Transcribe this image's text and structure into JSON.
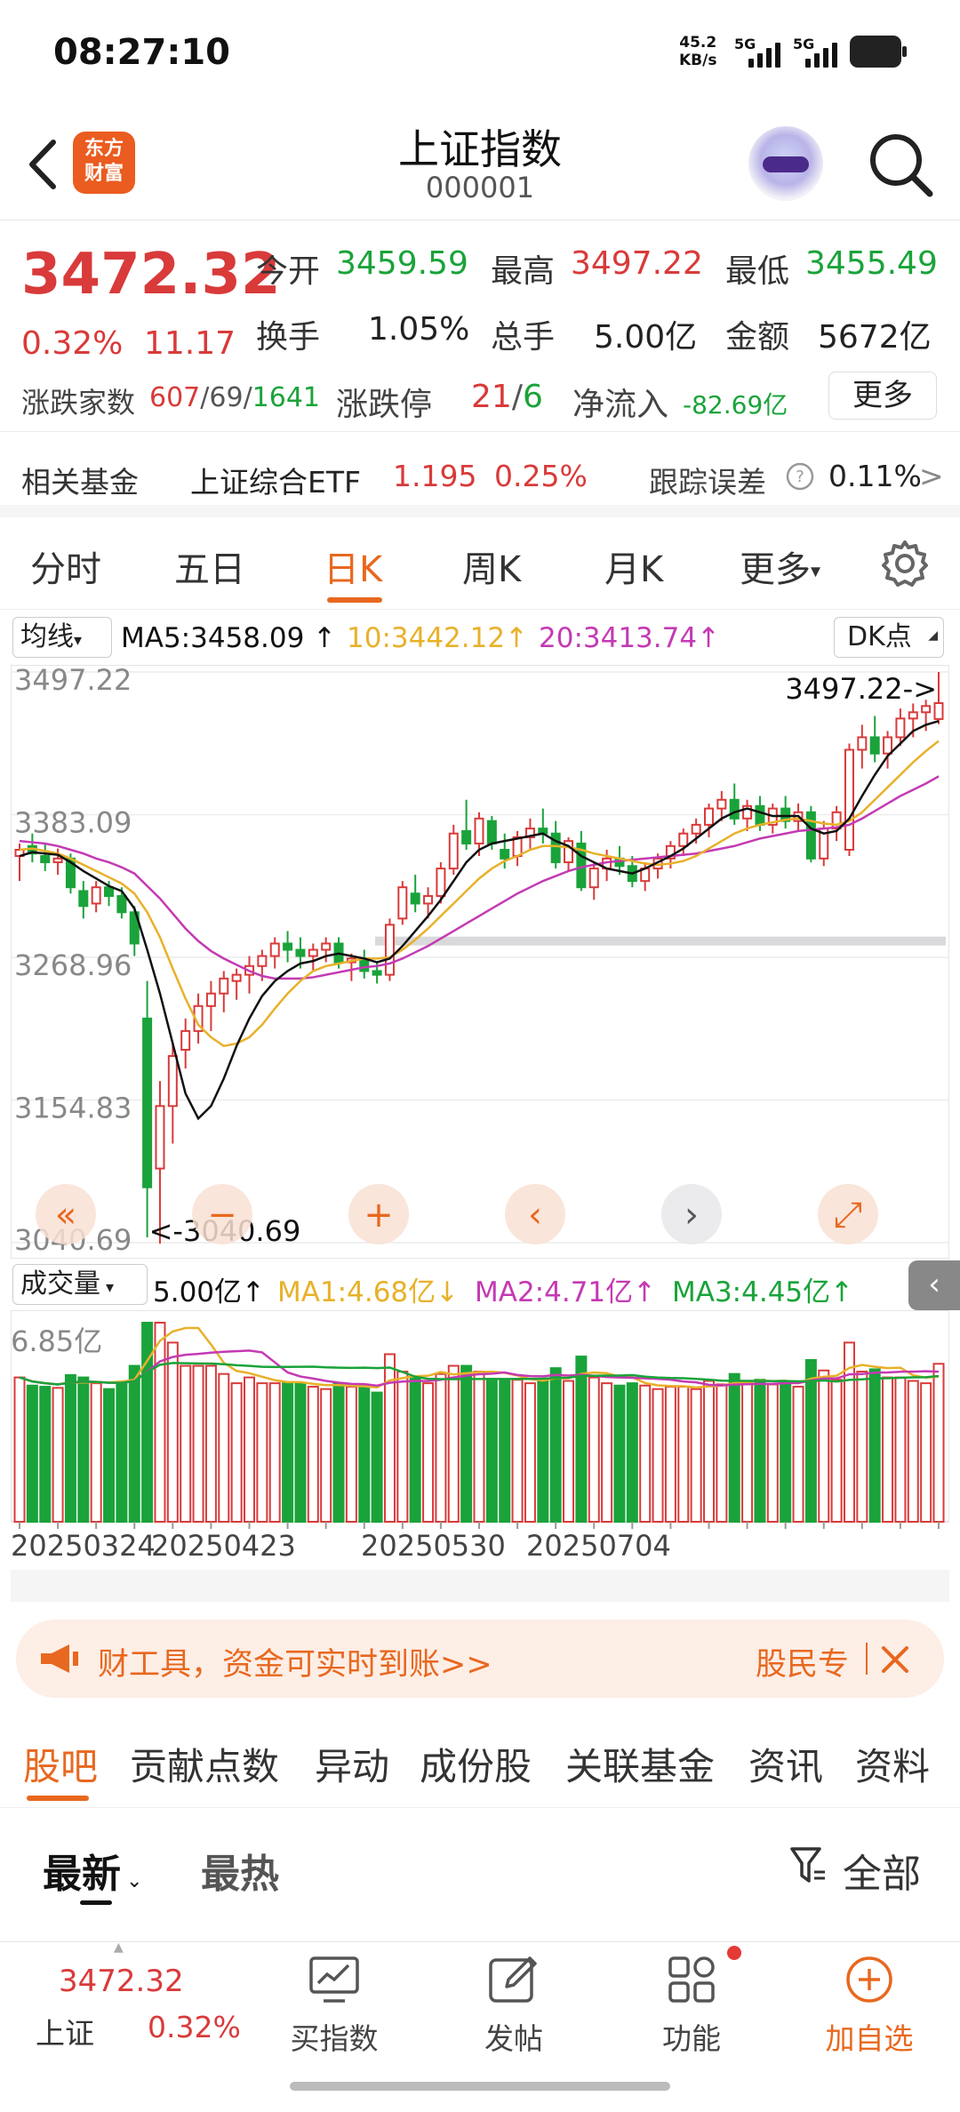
{
  "status_bar": {
    "time": "08:27:10",
    "net_speed": "45.2",
    "net_unit": "KB/s",
    "sim1": "5G",
    "sim2": "5G"
  },
  "header": {
    "title": "上证指数",
    "code": "000001",
    "logo_line1": "东方",
    "logo_line2": "财富"
  },
  "quote": {
    "price": "3472.32",
    "change_pct": "0.32%",
    "change": "11.17",
    "open_label": "今开",
    "open": "3459.59",
    "high_label": "最高",
    "high": "3497.22",
    "low_label": "最低",
    "low": "3455.49",
    "turnover_label": "换手",
    "turnover": "1.05%",
    "volume_label": "总手",
    "volume": "5.00亿",
    "amount_label": "金额",
    "amount": "5672亿",
    "breadth_label": "涨跌家数",
    "breadth_up": "607",
    "breadth_sep1": "/",
    "breadth_flat": "69",
    "breadth_sep2": "/",
    "breadth_down": "1641",
    "limit_label": "涨跌停",
    "limit_up": "21",
    "limit_sep": "/",
    "limit_down": "6",
    "netflow_label": "净流入",
    "netflow": "-82.69亿",
    "more_label": "更多"
  },
  "fund": {
    "label": "相关基金",
    "name": "上证综合ETF",
    "price": "1.195",
    "pct": "0.25%",
    "err_label": "跟踪误差",
    "err": "0.11%"
  },
  "tabs": [
    {
      "label": "分时"
    },
    {
      "label": "五日"
    },
    {
      "label": "日K"
    },
    {
      "label": "周K"
    },
    {
      "label": "月K"
    },
    {
      "label": "更多"
    }
  ],
  "ma_row": {
    "selector": "均线",
    "ma5": "MA5:3458.09",
    "ma10": "10:3442.12",
    "ma20": "20:3413.74",
    "dk": "DK点"
  },
  "kline": {
    "y_ticks": [
      "3497.22",
      "3383.09",
      "3268.96",
      "3154.83",
      "3040.69"
    ],
    "high_mark": "3497.22->",
    "low_mark": "<-3040.69"
  },
  "vol_row": {
    "selector": "成交量",
    "value": "5.00亿",
    "ma1": "MA1:4.68亿",
    "ma2": "MA2:4.71亿",
    "ma3": "MA3:4.45亿"
  },
  "volume": {
    "y_tick": "6.85亿",
    "dates": [
      "20250324",
      "20250423",
      "20250530",
      "20250704"
    ]
  },
  "ticker": {
    "text": "财工具，资金可实时到账>>",
    "right": "股民专"
  },
  "lower_tabs": [
    {
      "label": "股吧"
    },
    {
      "label": "贡献点数"
    },
    {
      "label": "异动"
    },
    {
      "label": "成份股"
    },
    {
      "label": "关联基金"
    },
    {
      "label": "资讯"
    },
    {
      "label": "资料"
    }
  ],
  "sort": {
    "latest": "最新",
    "hot": "最热",
    "filter": "全部"
  },
  "bottom_bar": {
    "index_price": "3472.32",
    "index_name": "上证",
    "index_pct": "0.32%",
    "buy": "买指数",
    "post": "发帖",
    "func": "功能",
    "add": "加自选"
  },
  "colors": {
    "up": "#d93a3a",
    "down": "#1aa33a",
    "accent": "#e8681f",
    "ma5": "#111111",
    "ma10": "#e8b12a",
    "ma20": "#c43ab3"
  },
  "chart_data": {
    "type": "candlestick",
    "ylim": [
      3040.69,
      3497.22
    ],
    "high": 3497.22,
    "low": 3040.69,
    "candles": [
      [
        3350,
        3360,
        3330,
        3355
      ],
      [
        3358,
        3368,
        3345,
        3352
      ],
      [
        3350,
        3360,
        3338,
        3345
      ],
      [
        3345,
        3356,
        3335,
        3348
      ],
      [
        3348,
        3352,
        3320,
        3325
      ],
      [
        3322,
        3330,
        3300,
        3310
      ],
      [
        3312,
        3330,
        3305,
        3325
      ],
      [
        3325,
        3330,
        3310,
        3318
      ],
      [
        3318,
        3325,
        3300,
        3305
      ],
      [
        3305,
        3310,
        3270,
        3280
      ],
      [
        3220,
        3250,
        3045,
        3085
      ],
      [
        3100,
        3170,
        3040,
        3150
      ],
      [
        3150,
        3200,
        3120,
        3190
      ],
      [
        3195,
        3220,
        3180,
        3210
      ],
      [
        3210,
        3240,
        3200,
        3230
      ],
      [
        3230,
        3250,
        3210,
        3240
      ],
      [
        3240,
        3258,
        3225,
        3252
      ],
      [
        3250,
        3260,
        3235,
        3255
      ],
      [
        3255,
        3270,
        3240,
        3262
      ],
      [
        3262,
        3275,
        3250,
        3270
      ],
      [
        3270,
        3285,
        3260,
        3280
      ],
      [
        3280,
        3290,
        3265,
        3275
      ],
      [
        3275,
        3285,
        3260,
        3270
      ],
      [
        3270,
        3280,
        3258,
        3275
      ],
      [
        3275,
        3285,
        3265,
        3280
      ],
      [
        3280,
        3285,
        3260,
        3265
      ],
      [
        3265,
        3272,
        3250,
        3268
      ],
      [
        3268,
        3275,
        3252,
        3258
      ],
      [
        3258,
        3265,
        3248,
        3255
      ],
      [
        3255,
        3300,
        3250,
        3295
      ],
      [
        3300,
        3330,
        3295,
        3325
      ],
      [
        3320,
        3335,
        3305,
        3312
      ],
      [
        3312,
        3325,
        3300,
        3318
      ],
      [
        3318,
        3345,
        3312,
        3340
      ],
      [
        3340,
        3375,
        3335,
        3368
      ],
      [
        3370,
        3395,
        3355,
        3360
      ],
      [
        3360,
        3385,
        3350,
        3380
      ],
      [
        3378,
        3382,
        3355,
        3360
      ],
      [
        3355,
        3368,
        3340,
        3348
      ],
      [
        3350,
        3370,
        3342,
        3365
      ],
      [
        3365,
        3380,
        3355,
        3372
      ],
      [
        3372,
        3388,
        3360,
        3368
      ],
      [
        3368,
        3378,
        3340,
        3345
      ],
      [
        3345,
        3365,
        3338,
        3362
      ],
      [
        3360,
        3370,
        3322,
        3325
      ],
      [
        3325,
        3345,
        3315,
        3340
      ],
      [
        3340,
        3355,
        3330,
        3348
      ],
      [
        3348,
        3358,
        3335,
        3342
      ],
      [
        3342,
        3350,
        3325,
        3330
      ],
      [
        3330,
        3345,
        3322,
        3340
      ],
      [
        3340,
        3352,
        3332,
        3348
      ],
      [
        3348,
        3362,
        3340,
        3358
      ],
      [
        3358,
        3372,
        3350,
        3368
      ],
      [
        3368,
        3380,
        3360,
        3375
      ],
      [
        3375,
        3392,
        3365,
        3388
      ],
      [
        3388,
        3402,
        3378,
        3395
      ],
      [
        3395,
        3408,
        3375,
        3380
      ],
      [
        3380,
        3395,
        3370,
        3390
      ],
      [
        3390,
        3398,
        3370,
        3375
      ],
      [
        3375,
        3392,
        3368,
        3388
      ],
      [
        3388,
        3398,
        3372,
        3378
      ],
      [
        3378,
        3392,
        3370,
        3385
      ],
      [
        3385,
        3390,
        3345,
        3348
      ],
      [
        3348,
        3378,
        3342,
        3372
      ],
      [
        3372,
        3390,
        3362,
        3385
      ],
      [
        3355,
        3440,
        3350,
        3435
      ],
      [
        3435,
        3455,
        3420,
        3445
      ],
      [
        3445,
        3462,
        3425,
        3432
      ],
      [
        3432,
        3450,
        3420,
        3445
      ],
      [
        3445,
        3468,
        3438,
        3460
      ],
      [
        3460,
        3472,
        3445,
        3465
      ],
      [
        3465,
        3475,
        3450,
        3470
      ],
      [
        3459.59,
        3497.22,
        3455.49,
        3472.32
      ]
    ],
    "ma5": [
      3350,
      3353,
      3352,
      3351,
      3345,
      3338,
      3332,
      3326,
      3322,
      3308,
      3275,
      3240,
      3200,
      3160,
      3140,
      3150,
      3172,
      3198,
      3220,
      3238,
      3250,
      3258,
      3264,
      3266,
      3270,
      3272,
      3270,
      3268,
      3265,
      3268,
      3278,
      3290,
      3302,
      3315,
      3330,
      3345,
      3355,
      3360,
      3362,
      3364,
      3366,
      3368,
      3362,
      3358,
      3350,
      3345,
      3340,
      3338,
      3336,
      3340,
      3345,
      3350,
      3356,
      3364,
      3372,
      3380,
      3385,
      3388,
      3385,
      3382,
      3382,
      3382,
      3372,
      3368,
      3370,
      3380,
      3398,
      3415,
      3430,
      3440,
      3450,
      3455,
      3458
    ],
    "ma10": [
      3355,
      3356,
      3354,
      3352,
      3348,
      3343,
      3338,
      3333,
      3328,
      3320,
      3305,
      3285,
      3260,
      3236,
      3215,
      3205,
      3198,
      3200,
      3205,
      3215,
      3228,
      3240,
      3250,
      3258,
      3262,
      3264,
      3266,
      3268,
      3268,
      3269,
      3275,
      3283,
      3292,
      3302,
      3312,
      3322,
      3332,
      3340,
      3346,
      3350,
      3355,
      3358,
      3358,
      3357,
      3355,
      3352,
      3350,
      3348,
      3346,
      3344,
      3343,
      3344,
      3346,
      3350,
      3356,
      3362,
      3368,
      3372,
      3375,
      3377,
      3379,
      3380,
      3378,
      3376,
      3375,
      3378,
      3385,
      3395,
      3405,
      3415,
      3425,
      3434,
      3442
    ],
    "ma20": [
      3362,
      3361,
      3360,
      3358,
      3355,
      3352,
      3348,
      3345,
      3341,
      3336,
      3326,
      3316,
      3304,
      3292,
      3282,
      3274,
      3268,
      3263,
      3258,
      3254,
      3252,
      3252,
      3252,
      3253,
      3255,
      3257,
      3259,
      3261,
      3262,
      3264,
      3268,
      3273,
      3278,
      3284,
      3290,
      3296,
      3302,
      3308,
      3314,
      3320,
      3325,
      3330,
      3334,
      3338,
      3341,
      3343,
      3345,
      3346,
      3347,
      3348,
      3349,
      3350,
      3351,
      3352,
      3354,
      3356,
      3358,
      3361,
      3364,
      3366,
      3368,
      3370,
      3371,
      3372,
      3373,
      3375,
      3380,
      3386,
      3392,
      3398,
      3403,
      3408,
      3413.74
    ]
  }
}
